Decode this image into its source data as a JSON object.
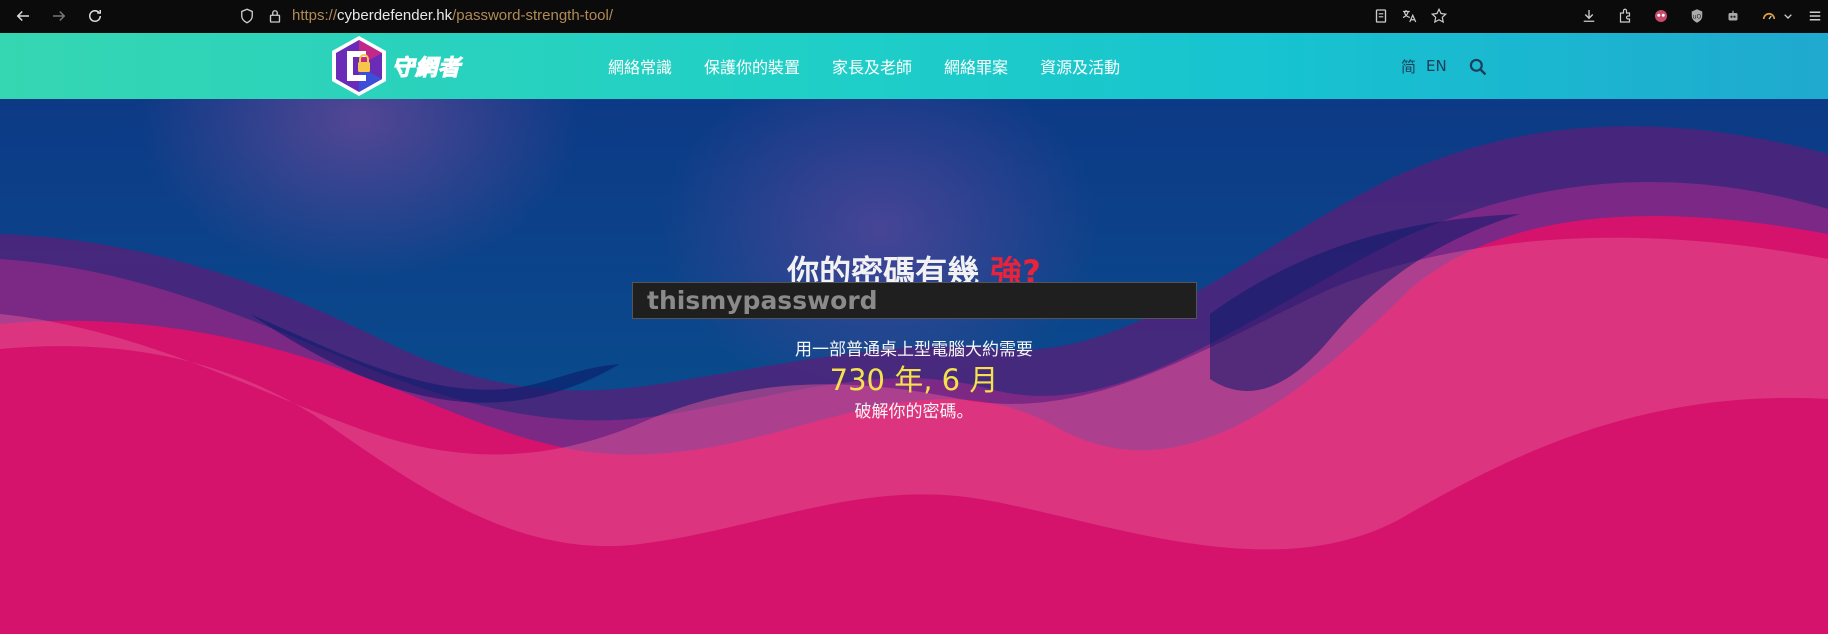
{
  "browser": {
    "url_scheme": "https://",
    "url_host": "cyberdefender.hk",
    "url_path": "/password-strength-tool/",
    "icons": [
      "back-icon",
      "forward-icon",
      "reload-icon",
      "shield-icon",
      "lock-icon",
      "reader-icon",
      "translate-icon",
      "star-icon",
      "download-icon",
      "extensions-icon",
      "account-icon",
      "ublock-icon",
      "robot-icon",
      "gauge-icon",
      "chevron-down-icon",
      "menu-icon"
    ]
  },
  "header": {
    "logo_text": "守網者",
    "nav": [
      "網絡常識",
      "保護你的裝置",
      "家長及老師",
      "網絡罪案",
      "資源及活動"
    ],
    "lang_sc": "简",
    "lang_en": "EN"
  },
  "hero": {
    "title": "你的密碼有幾",
    "title_accent": "強?",
    "password_value": "thismypassword",
    "result_prefix": "用一部普通桌上型電腦大約需要",
    "result_time": "730 年, 6 月",
    "result_suffix": "破解你的密碼。"
  },
  "colors": {
    "accent_red": "#e8233a",
    "time_yellow": "#f4e24c",
    "header_start": "#35d6b2",
    "header_end": "#1fa9cf",
    "hero_blue": "#0d3a86",
    "wave_pink": "#d5136c"
  }
}
